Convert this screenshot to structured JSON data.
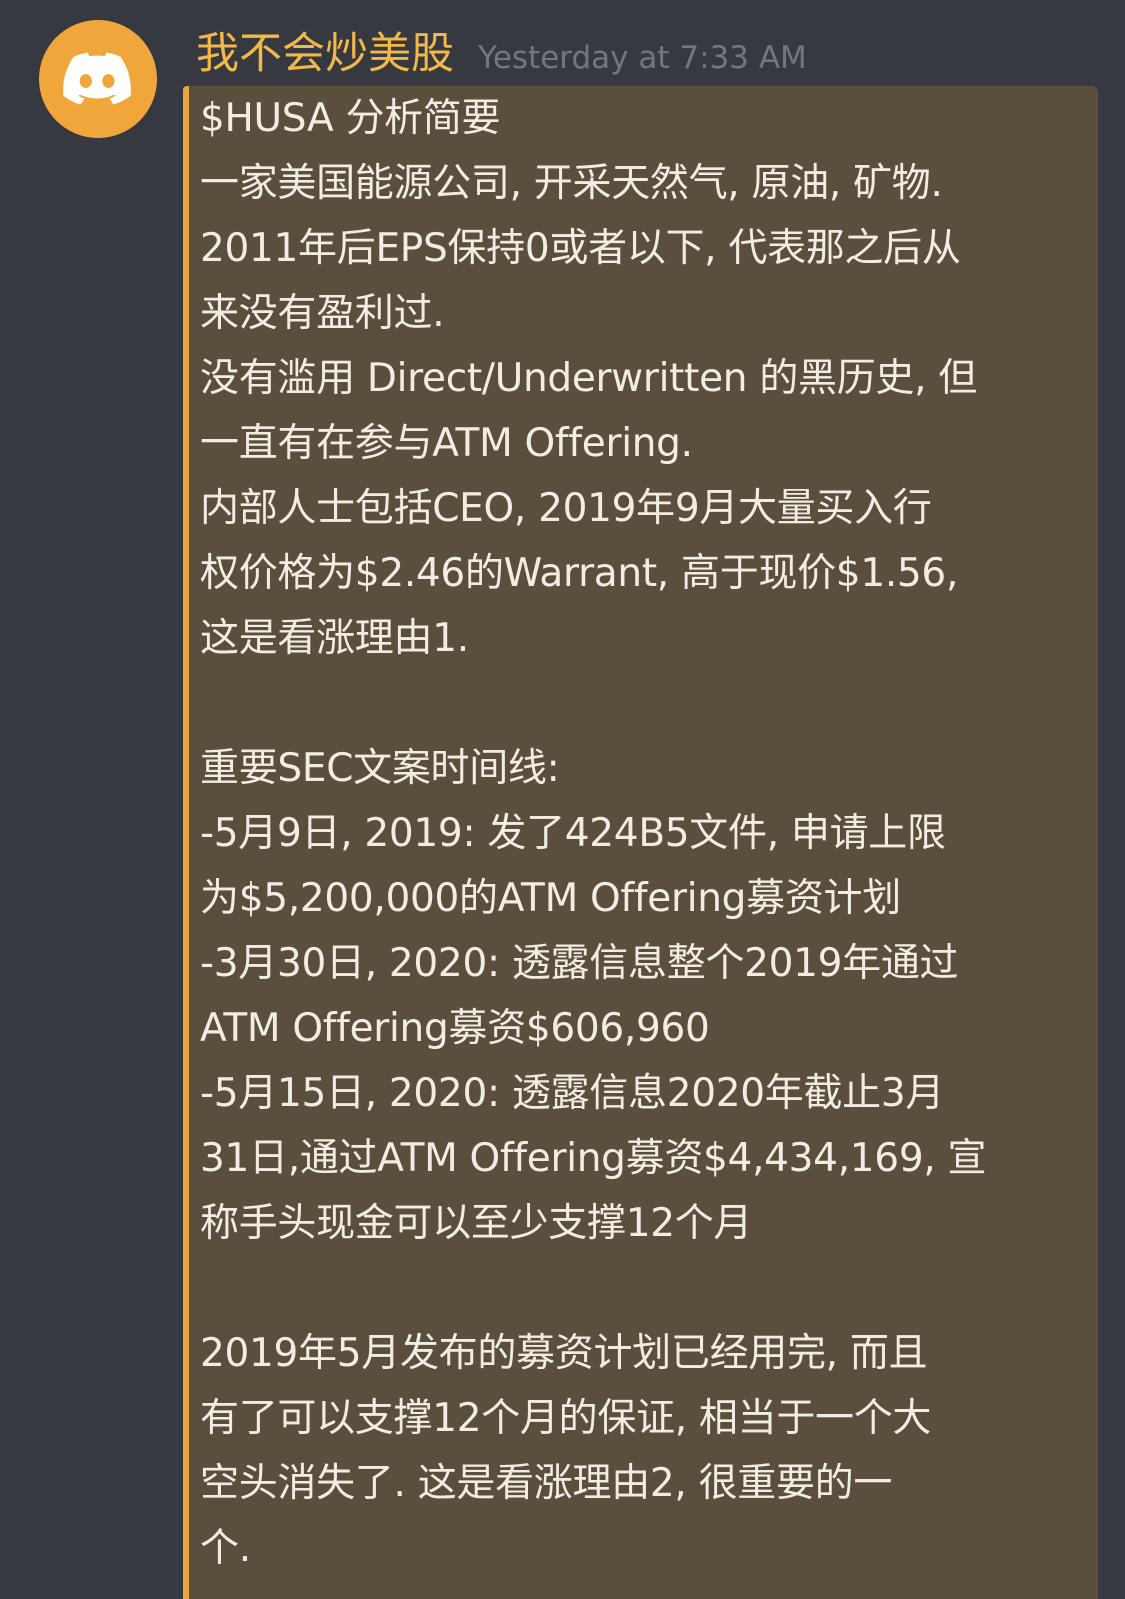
{
  "message": {
    "username": "我不会炒美股",
    "timestamp": "Yesterday at 7:33 AM",
    "avatar_icon": "discord-logo-icon",
    "colors": {
      "background": "#36393f",
      "username": "#f2b84a",
      "timestamp": "#72767d",
      "embed_background": "#5a4f3c",
      "embed_accent": "#e8a93a",
      "avatar_background": "#f0a63a",
      "text": "#f1ede4"
    },
    "lines": [
      "$HUSA 分析简要",
      "一家美国能源公司, 开采天然气, 原油, 矿物.",
      "2011年后EPS保持0或者以下, 代表那之后从",
      "来没有盈利过.",
      "没有滥用 Direct/Underwritten 的黑历史, 但",
      "一直有在参与ATM Offering.",
      "内部人士包括CEO, 2019年9月大量买入行",
      "权价格为$2.46的Warrant, 高于现价$1.56,",
      "这是看涨理由1.",
      "",
      "重要SEC文案时间线:",
      "-5月9日, 2019: 发了424B5文件, 申请上限",
      "为$5,200,000的ATM Offering募资计划",
      "-3月30日, 2020: 透露信息整个2019年通过",
      "ATM Offering募资$606,960",
      "-5月15日, 2020: 透露信息2020年截止3月",
      "31日,通过ATM Offering募资$4,434,169, 宣",
      "称手头现金可以至少支撑12个月",
      "",
      "2019年5月发布的募资计划已经用完, 而且",
      "有了可以支撑12个月的保证, 相当于一个大",
      "空头消失了. 这是看涨理由2, 很重要的一",
      "个."
    ]
  }
}
